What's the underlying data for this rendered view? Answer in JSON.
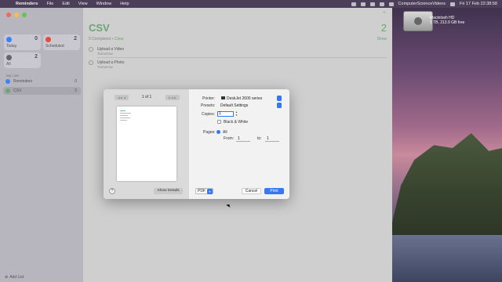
{
  "menubar": {
    "app_name": "Reminders",
    "items": [
      "File",
      "Edit",
      "View",
      "Window",
      "Help"
    ],
    "status_text": "ComputerScienceVideos",
    "clock": "Fri 17 Feb  22:38:58"
  },
  "desktop": {
    "disk_label": "Macintosh HD",
    "disk_sublabel": "1 TB, 213.9 GB free"
  },
  "sidebar": {
    "smart_lists": [
      {
        "label": "Today",
        "count": "0",
        "color": "#3a82f7"
      },
      {
        "label": "Scheduled",
        "count": "2",
        "color": "#e44b3b"
      },
      {
        "label": "All",
        "count": "2",
        "color": "#5f6670"
      }
    ],
    "my_lists_title": "My Lists",
    "lists": [
      {
        "label": "Reminders",
        "count": "0",
        "color": "#3a82f7"
      },
      {
        "label": "CSV",
        "count": "2",
        "color": "#6da577"
      }
    ],
    "add_list": "Add List"
  },
  "main": {
    "title": "CSV",
    "count": "2",
    "completed_text": "0 Completed",
    "clear_text": "Clear",
    "show_text": "Show",
    "reminders": [
      {
        "title": "Upload a Video",
        "subtitle": "Tomorrow"
      },
      {
        "title": "Upload a Photo",
        "subtitle": "Tomorrow"
      }
    ]
  },
  "print_dialog": {
    "page_indicator": "1 of 1",
    "printer_label": "Printer:",
    "printer_value": "DeskJet 2600 series",
    "presets_label": "Presets:",
    "presets_value": "Default Settings",
    "copies_label": "Copies:",
    "copies_value": "1",
    "bw_label": "Black & White",
    "pages_label": "Pages:",
    "pages_all": "All",
    "from_label": "From:",
    "from_value": "1",
    "to_label": "to:",
    "to_value": "1",
    "help_label": "?",
    "show_details": "Show Details",
    "pdf_label": "PDF",
    "cancel_label": "Cancel",
    "print_label": "Print"
  }
}
